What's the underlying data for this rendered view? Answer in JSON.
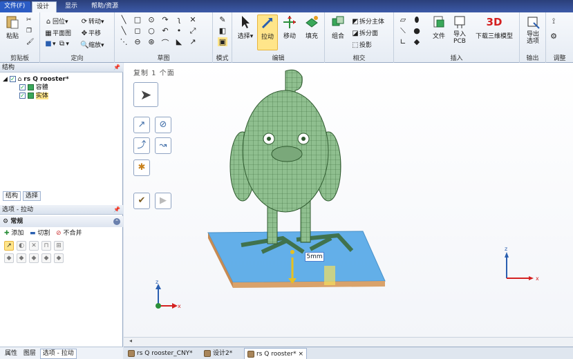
{
  "tabs": [
    "文件(F)",
    "设计",
    "显示",
    "帮助/资源"
  ],
  "active_tab": "设计",
  "ribbon": {
    "clipboard": {
      "label": "剪贴板",
      "paste": "粘贴"
    },
    "orient": {
      "label": "定向",
      "home": "回位",
      "rotate": "转动",
      "plan": "平面图",
      "pan": "平移",
      "zoom": "缩放"
    },
    "sketch": {
      "label": "草图"
    },
    "mode": {
      "label": "模式"
    },
    "edit": {
      "label": "编辑",
      "select": "选择",
      "pull": "拉动",
      "move": "移动",
      "fill": "填充"
    },
    "intersect": {
      "label": "相交",
      "combine": "组合",
      "split_body": "拆分主体",
      "split_face": "拆分面",
      "project": "投影"
    },
    "insert": {
      "label": "插入",
      "file": "文件",
      "import_pcb": "导入\nPCB",
      "download_3d": "下载三维模型"
    },
    "output": {
      "label": "输出",
      "export": "导出\n选项"
    },
    "adjust": {
      "label": "调整"
    }
  },
  "structure": {
    "title": "结构",
    "root": "rs Q rooster*",
    "items": [
      "容體",
      "实体"
    ]
  },
  "small_tabs": [
    "结构",
    "选择"
  ],
  "options": {
    "title": "选项 - 拉动",
    "section": "常规",
    "add": "添加",
    "cut": "切割",
    "no_merge": "不合并"
  },
  "bottom_tabs": [
    "属性",
    "图层",
    "选项 - 拉动"
  ],
  "viewport": {
    "header": "复制 1 个面",
    "dimension": "5mm"
  },
  "doc_tabs": [
    "rs Q rooster_CNY*",
    "设计2*",
    "rs Q rooster*"
  ],
  "colors": {
    "accent": "#ffe58a",
    "model": "#8fbf8f",
    "base": "#d9a26a",
    "select": "#4aa3e6"
  }
}
